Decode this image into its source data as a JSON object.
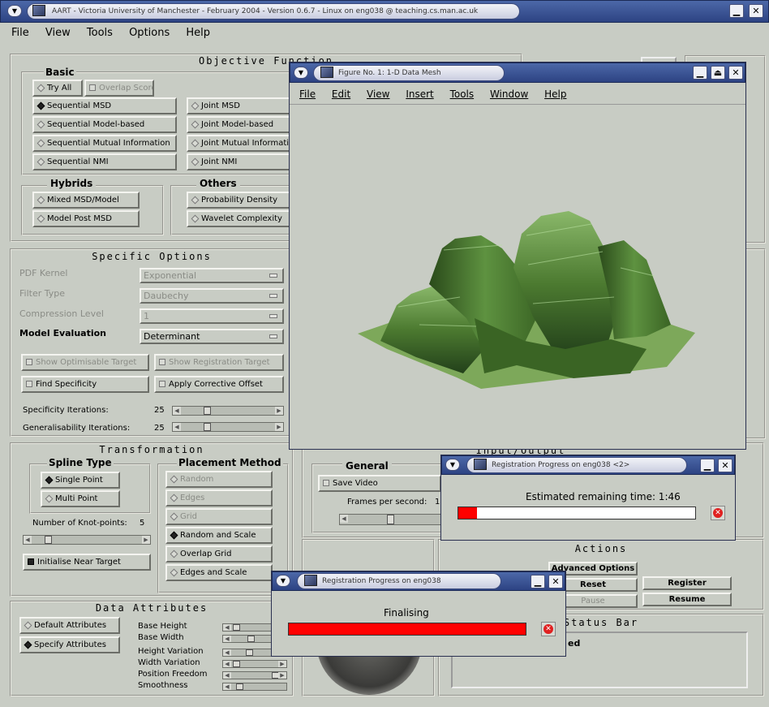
{
  "main_window": {
    "title": "AART - Victoria University of Manchester - February 2004 - Version 0.6.7 - Linux on eng038 @ teaching.cs.man.ac.uk",
    "menu": [
      "File",
      "View",
      "Tools",
      "Options",
      "Help"
    ]
  },
  "objective_function": {
    "title": "Objective Function",
    "basic": {
      "label": "Basic",
      "try_all": "Try All",
      "overlap_scores": "Overlap Scores",
      "options_left": [
        "Sequential MSD",
        "Sequential Model-based",
        "Sequential Mutual Information",
        "Sequential NMI"
      ],
      "options_right": [
        "Joint MSD",
        "Joint Model-based",
        "Joint Mutual Information",
        "Joint NMI"
      ]
    },
    "hybrids": {
      "label": "Hybrids",
      "options": [
        "Mixed MSD/Model",
        "Model Post MSD"
      ]
    },
    "others": {
      "label": "Others",
      "options": [
        "Probability Density",
        "Wavelet Complexity"
      ]
    }
  },
  "specific_options": {
    "title": "Specific Options",
    "rows": [
      {
        "label": "PDF Kernel",
        "value": "Exponential"
      },
      {
        "label": "Filter Type",
        "value": "Daubechy"
      },
      {
        "label": "Compression Level",
        "value": "1"
      },
      {
        "label": "Model Evaluation",
        "value": "Determinant"
      }
    ],
    "show_optimisable_target": "Show Optimisable Target",
    "show_registration_target": "Show Registration Target",
    "find_specificity": "Find Specificity",
    "apply_corrective_offset": "Apply Corrective Offset",
    "specificity_iterations_label": "Specificity Iterations:",
    "specificity_iterations_value": "25",
    "generalisability_iterations_label": "Generalisability Iterations:",
    "generalisability_iterations_value": "25"
  },
  "transformation": {
    "title": "Transformation",
    "spline_type": {
      "label": "Spline Type",
      "options": [
        "Single Point",
        "Multi Point"
      ]
    },
    "knot_points_label": "Number of Knot-points:",
    "knot_points_value": "5",
    "initialise_near_target": "Initialise Near Target",
    "placement_method": {
      "label": "Placement Method",
      "options": [
        "Random",
        "Edges",
        "Grid",
        "Random and Scale",
        "Overlap Grid",
        "Edges and Scale"
      ]
    }
  },
  "data_attributes": {
    "title": "Data Attributes",
    "default_attributes": "Default Attributes",
    "specify_attributes": "Specify Attributes",
    "sliders": [
      "Base Height",
      "Base Width",
      "Height Variation",
      "Width Variation",
      "Position Freedom",
      "Smoothness"
    ]
  },
  "input_output": {
    "title": "Input/Output",
    "general_label": "General",
    "save_video": "Save Video",
    "frames_per_second_label": "Frames per second:",
    "frames_per_second_value": "1"
  },
  "actions": {
    "title": "Actions",
    "advanced_options": "Advanced Options",
    "reset": "Reset",
    "pause": "Pause",
    "register": "Register",
    "resume": "Resume"
  },
  "status_bar": {
    "title": "Status Bar",
    "text": "ed"
  },
  "figure_window": {
    "title": "Figure No. 1: 1-D Data Mesh",
    "menu": [
      "File",
      "Edit",
      "View",
      "Insert",
      "Tools",
      "Window",
      "Help"
    ]
  },
  "progress_window_1": {
    "title": "Registration Progress on eng038  <2>",
    "message": "Estimated remaining time: 1:46",
    "progress": 0.08
  },
  "progress_window_2": {
    "title": "Registration Progress on eng038",
    "message": "Finalising",
    "progress": 1.0
  },
  "colors": {
    "desktop": "#3d5f9a",
    "panel": "#c8ccc4",
    "progress_fill": "#ff0000",
    "mesh": "#5a8a3a"
  }
}
